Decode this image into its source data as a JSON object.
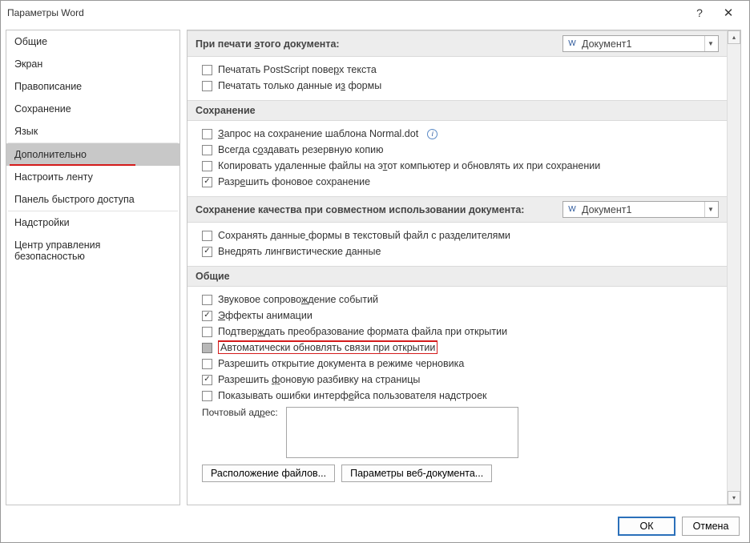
{
  "titlebar": {
    "title": "Параметры Word"
  },
  "sidebar": {
    "items": [
      {
        "label": "Общие"
      },
      {
        "label": "Экран"
      },
      {
        "label": "Правописание"
      },
      {
        "label": "Сохранение"
      },
      {
        "label": "Язык"
      },
      {
        "label": "Дополнительно",
        "selected": true,
        "red_underline": true
      },
      {
        "label": "Настроить ленту"
      },
      {
        "label": "Панель быстрого доступа"
      },
      {
        "label": "Надстройки"
      },
      {
        "label": "Центр управления безопасностью"
      }
    ]
  },
  "sections": {
    "print_doc": {
      "title": "При печати этого документа:",
      "doc_selected": "Документ1",
      "opts": [
        {
          "label": "Печатать PostScript поверх текста",
          "checked": false,
          "u_index": 24
        },
        {
          "label": "Печатать только данные из формы",
          "checked": false,
          "u_index": 24
        }
      ]
    },
    "save": {
      "title": "Сохранение",
      "opts": [
        {
          "label": "Запрос на сохранение шаблона Normal.dot",
          "checked": false,
          "info": true,
          "u_index": 0
        },
        {
          "label": "Всегда создавать резервную копию",
          "checked": false,
          "u_index": 8
        },
        {
          "label": "Копировать удаленные файлы на этот компьютер и обновлять их при сохранении",
          "checked": false,
          "u_index": 31
        },
        {
          "label": "Разрешить фоновое сохранение",
          "checked": true,
          "u_index": 4
        }
      ]
    },
    "share_quality": {
      "title": "Сохранение качества при совместном использовании документа:",
      "doc_selected": "Документ1",
      "opts": [
        {
          "label": "Сохранять данные формы в текстовый файл с разделителями",
          "checked": false,
          "u_index": 16
        },
        {
          "label": "Внедрять лингвистические данные",
          "checked": true
        }
      ]
    },
    "general": {
      "title": "Общие",
      "opts": [
        {
          "label": "Звуковое сопровождение событий",
          "checked": false,
          "u_index": 16
        },
        {
          "label": "Эффекты анимации",
          "checked": true,
          "u_index": 0
        },
        {
          "label": "Подтверждать преобразование формата файла при открытии",
          "checked": false,
          "u_index": 7
        },
        {
          "label": "Автоматически обновлять связи при открытии",
          "checked": false,
          "gray": true,
          "highlight": true
        },
        {
          "label": "Разрешить открытие документа в режиме черновика",
          "checked": false
        },
        {
          "label": "Разрешить фоновую разбивку на страницы",
          "checked": true,
          "u_index": 10
        },
        {
          "label": "Показывать ошибки интерфейса пользователя надстроек",
          "checked": false,
          "u_index": 24
        }
      ],
      "mail_label": "Почтовый адрес:",
      "mail_value": "",
      "btn_file_locations": "Расположение файлов...",
      "btn_web_options": "Параметры веб-документа..."
    }
  },
  "footer": {
    "ok": "ОК",
    "cancel": "Отмена"
  }
}
